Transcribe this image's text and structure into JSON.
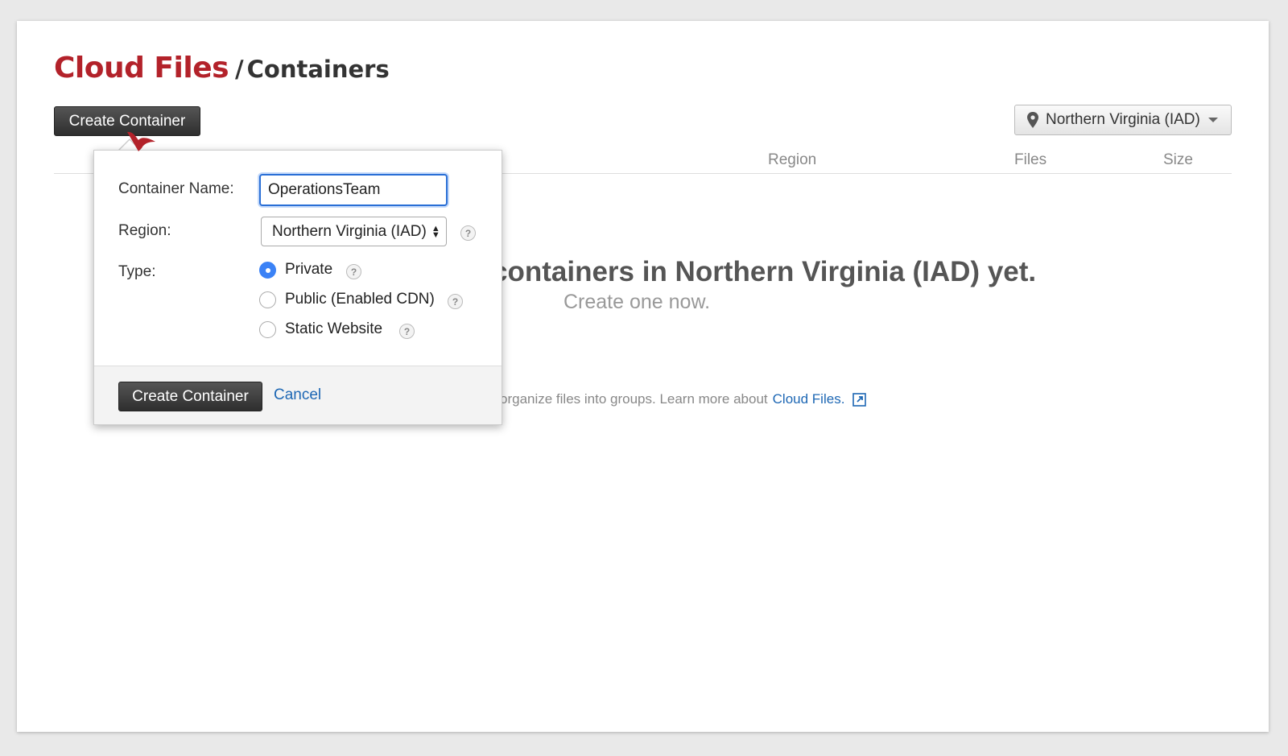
{
  "header": {
    "brand": "Cloud Files",
    "separator": "/",
    "section": "Containers"
  },
  "toolbar": {
    "create_label": "Create Container",
    "region_selected": "Northern Virginia (IAD)"
  },
  "table": {
    "columns": [
      "Region",
      "Files",
      "Size"
    ]
  },
  "empty_state": {
    "title": "containers in Northern Virginia (IAD) yet.",
    "subtitle": "Create one now.",
    "learn_text": "organize files into groups. Learn more about",
    "learn_link": "Cloud Files."
  },
  "popover": {
    "name_label": "Container Name:",
    "name_value": "OperationsTeam",
    "region_label": "Region:",
    "region_value": "Northern Virginia (IAD)",
    "type_label": "Type:",
    "types": [
      {
        "label": "Private",
        "selected": true
      },
      {
        "label": "Public (Enabled CDN)",
        "selected": false
      },
      {
        "label": "Static Website",
        "selected": false
      }
    ],
    "help_glyph": "?",
    "create_label": "Create Container",
    "cancel_label": "Cancel"
  },
  "colors": {
    "brand": "#b3222a",
    "link": "#1d67b4",
    "radio_selected": "#3b82f6"
  }
}
